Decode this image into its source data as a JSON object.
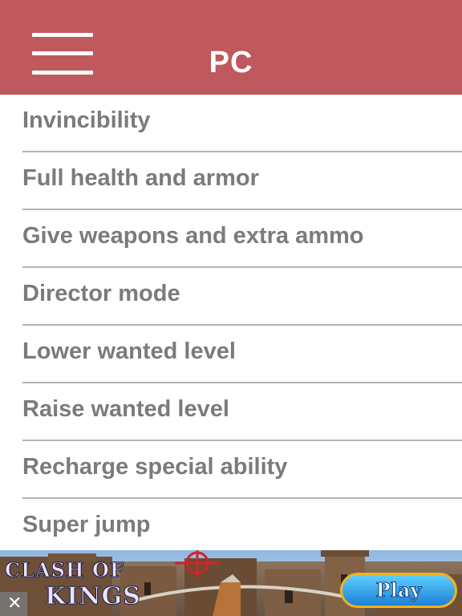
{
  "header": {
    "title": "PC",
    "background": "#c0595e",
    "menu_icon": "hamburger-menu-icon"
  },
  "list": {
    "items": [
      {
        "label": "Invincibility"
      },
      {
        "label": "Full health and armor"
      },
      {
        "label": "Give weapons and extra ammo"
      },
      {
        "label": "Director mode"
      },
      {
        "label": "Lower wanted level"
      },
      {
        "label": "Raise wanted level"
      },
      {
        "label": "Recharge special ability"
      },
      {
        "label": "Super jump"
      }
    ],
    "text_color": "#7b7b7b",
    "divider_color": "#b3b3b3"
  },
  "ad": {
    "brand_line1": "CLASH OF",
    "brand_line2": "KINGS",
    "play_label": "Play",
    "close_icon": "close-icon",
    "crosshair_icon": "crosshair-icon"
  }
}
